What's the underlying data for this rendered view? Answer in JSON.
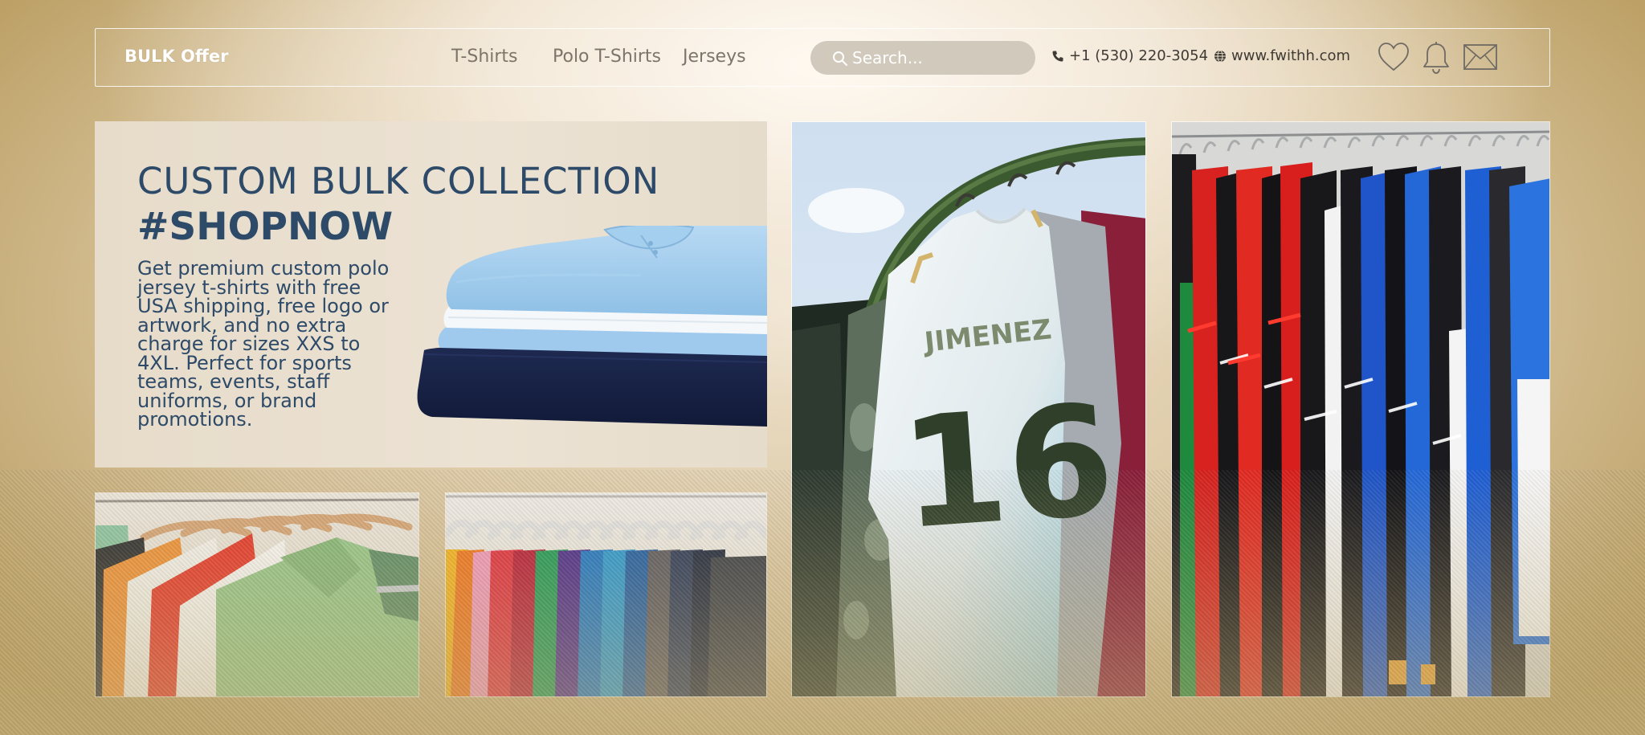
{
  "header": {
    "brand": "BULK Offer",
    "nav": [
      "T-Shirts",
      "Polo T-Shirts",
      "Jerseys"
    ],
    "search_placeholder": "Search...",
    "phone": "+1 (530) 220-3054",
    "website": "www.fwithh.com",
    "icons": [
      "heart-icon",
      "bell-icon",
      "mail-icon"
    ]
  },
  "hero": {
    "title": "CUSTOM BULK COLLECTION",
    "hashtag": "#SHOPNOW",
    "body": "Get premium custom polo jersey t-shirts with free USA shipping, free logo or artwork, and no extra charge for sizes XXS to 4XL. Perfect for sports teams, events, staff uniforms, or brand promotions."
  },
  "jersey_photo": {
    "name_print": "JIMENEZ",
    "number_print": "16"
  },
  "colors": {
    "navy_text": "#2d4a69",
    "nav_text": "#7e756a",
    "search_bg": "#d2c9bd"
  }
}
